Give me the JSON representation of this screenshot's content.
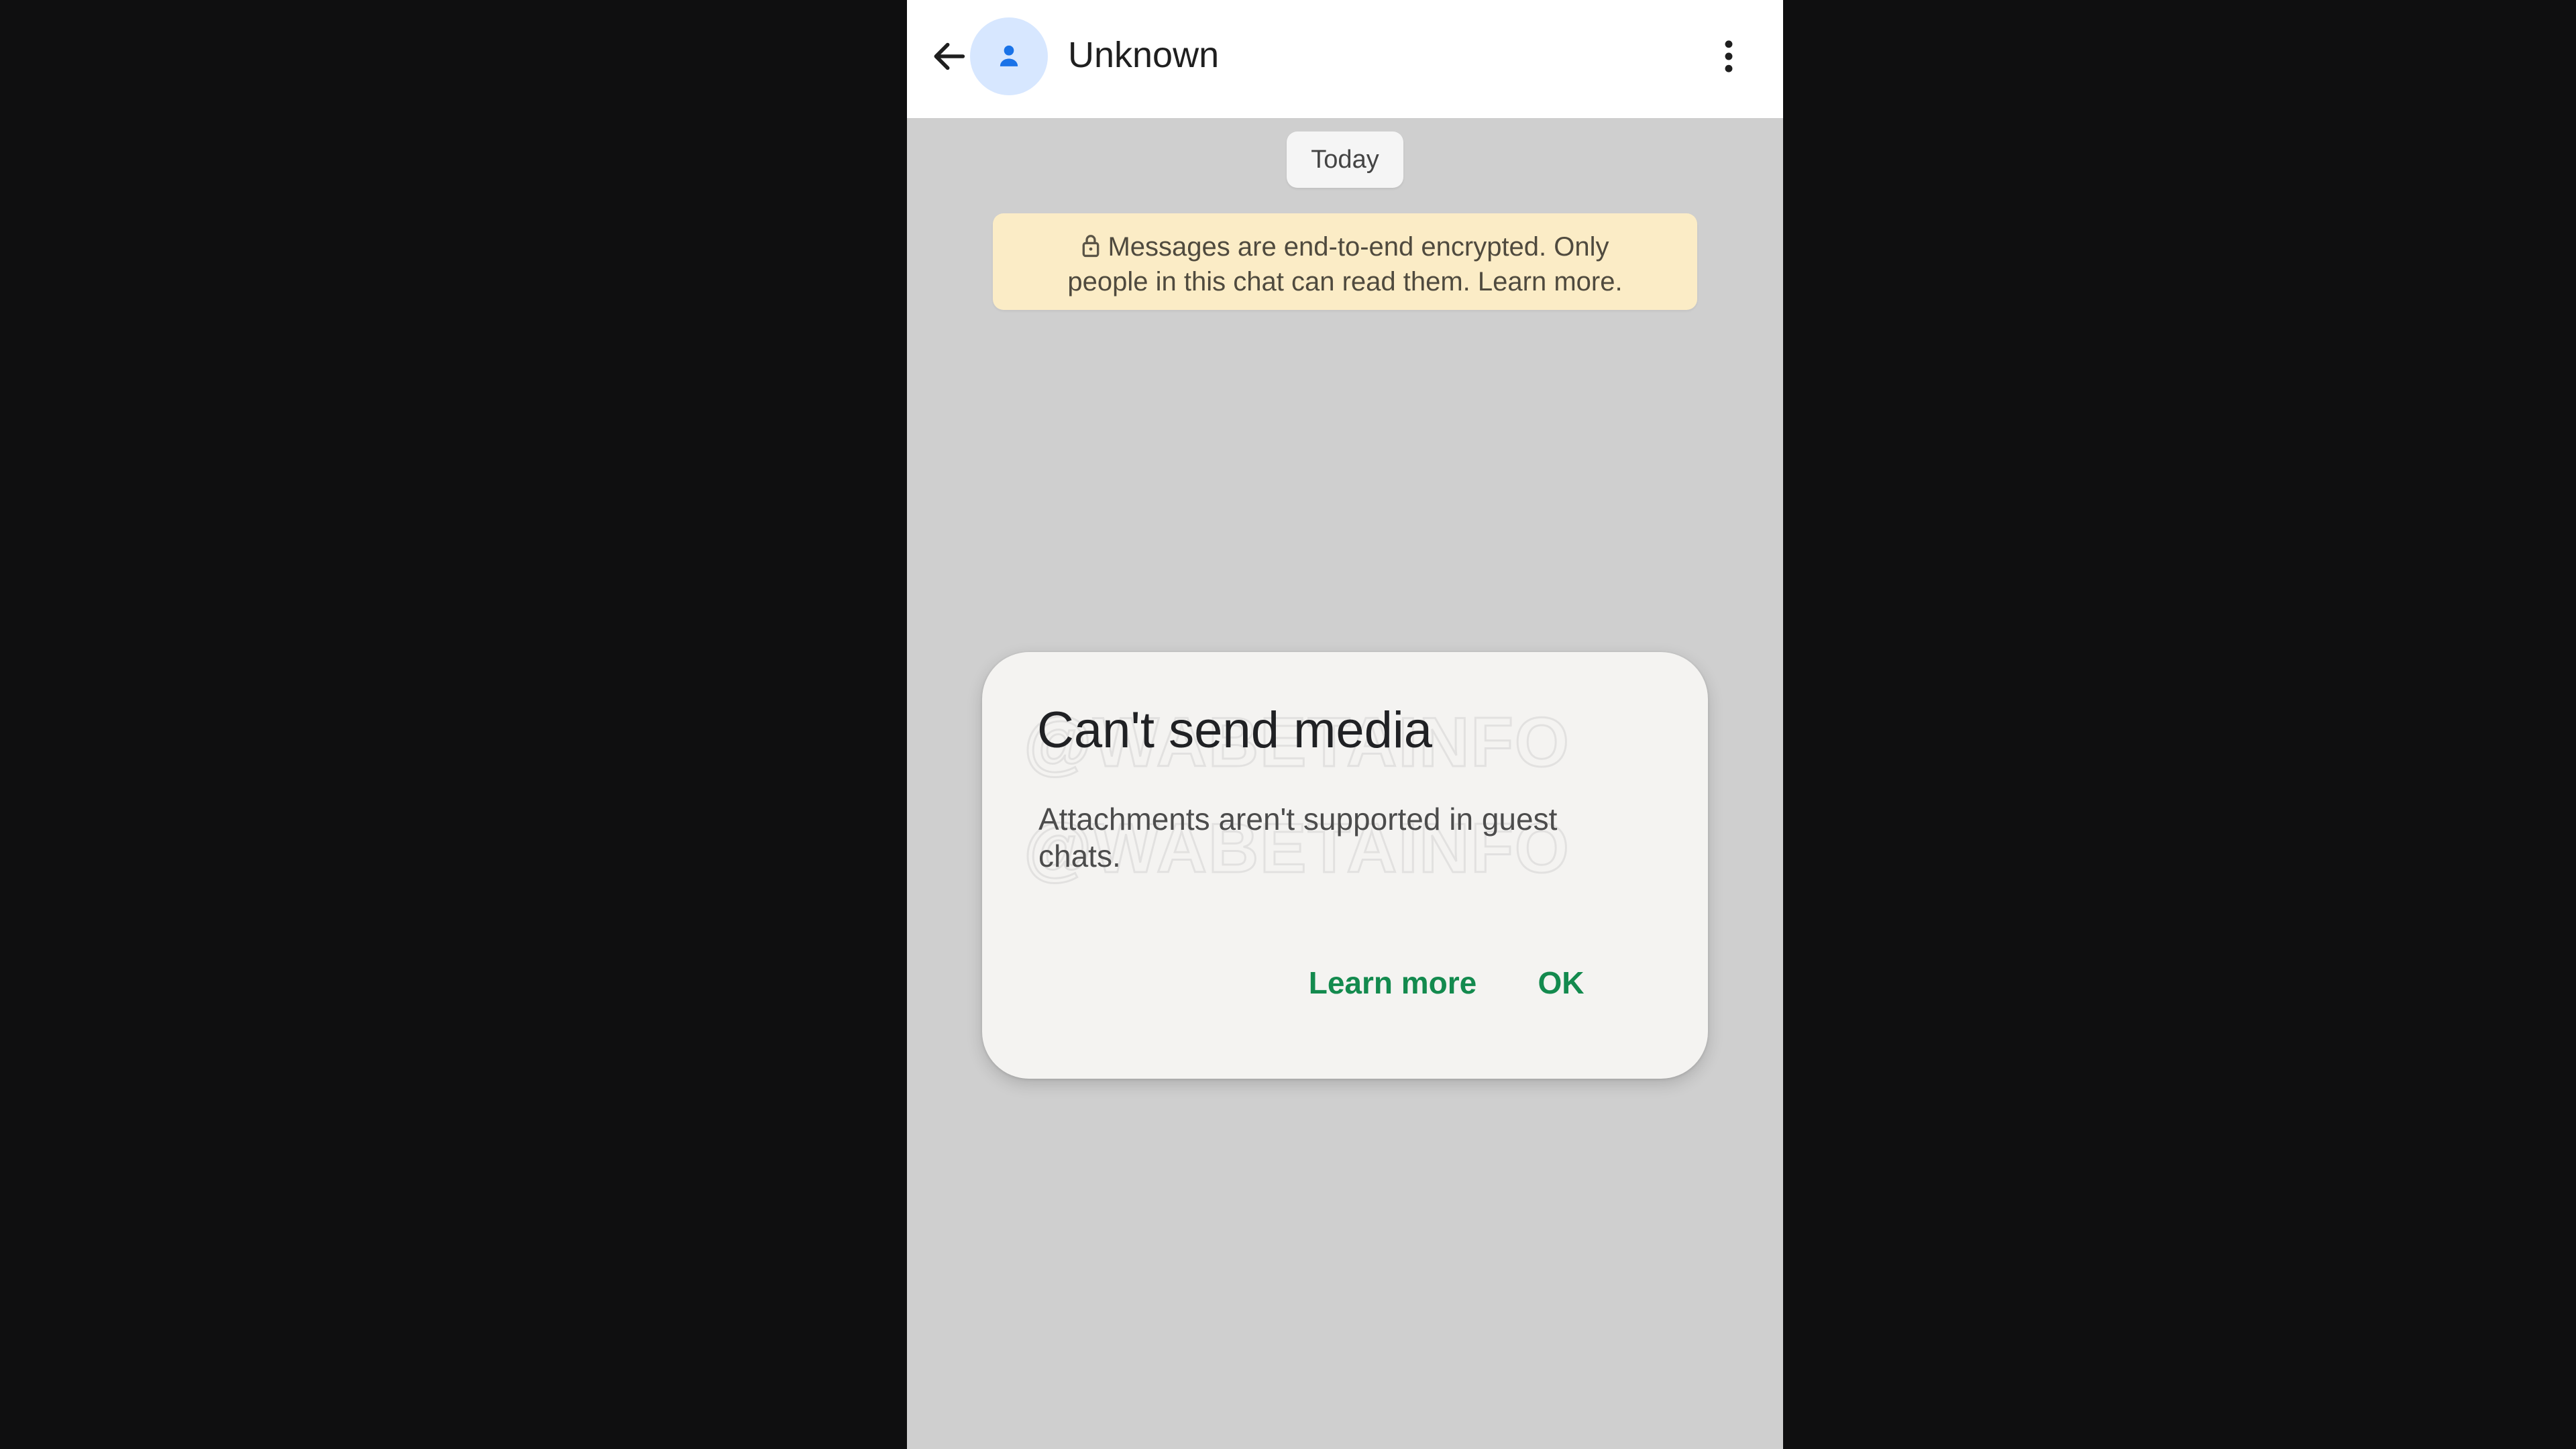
{
  "header": {
    "contact_name": "Unknown",
    "back_icon": "arrow-left-icon",
    "avatar_icon": "person-icon",
    "menu_icon": "more-vert-icon"
  },
  "chat": {
    "date_chip": "Today",
    "encryption_notice_line1": "Messages are end-to-end encrypted. Only",
    "encryption_notice_line2": "people in this chat can read them. Learn more."
  },
  "dialog": {
    "title": "Can't send media",
    "body": "Attachments aren't supported in guest chats.",
    "learn_more_label": "Learn more",
    "ok_label": "OK",
    "watermark_text": "@WABETAINFO"
  },
  "colors": {
    "header_background": "#ffffff",
    "chat_background": "#cfcfcf",
    "avatar_background": "#d7e7ff",
    "avatar_icon": "#1a73e8",
    "dialog_background": "#f4f3f1",
    "accent_green": "#138a4e",
    "encryption_banner": "#fbecc6"
  }
}
